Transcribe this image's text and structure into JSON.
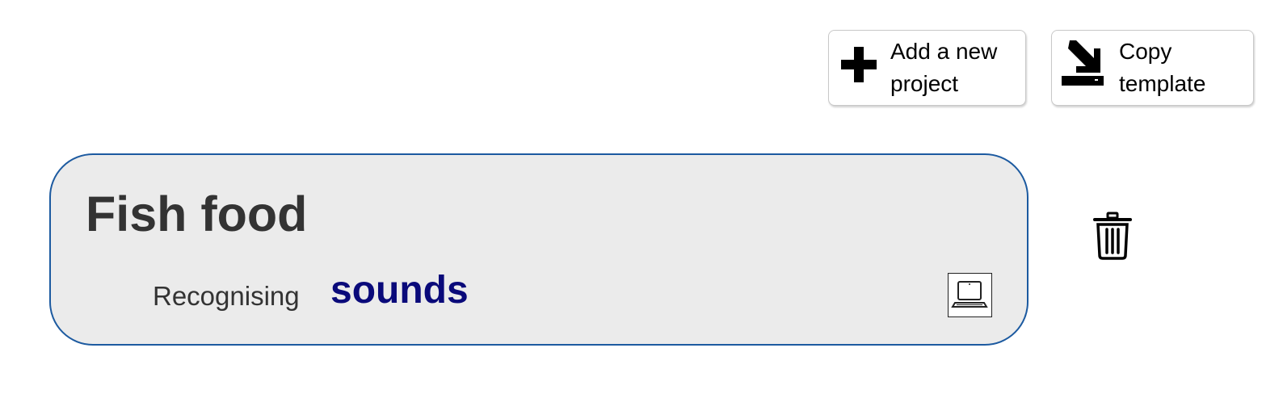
{
  "toolbar": {
    "add_project": {
      "label": "Add a new project",
      "icon": "plus-icon"
    },
    "copy_template": {
      "label": "Copy template",
      "icon": "import-icon"
    }
  },
  "projects": [
    {
      "name": "Fish food",
      "type_label": "Recognising",
      "type_value": "sounds",
      "storage_icon": "laptop-icon",
      "delete_icon": "trash-icon"
    }
  ],
  "colors": {
    "card_background": "#ebebeb",
    "card_border": "#1c5aa0",
    "type_value": "#0a0a7a",
    "text": "#333333"
  }
}
